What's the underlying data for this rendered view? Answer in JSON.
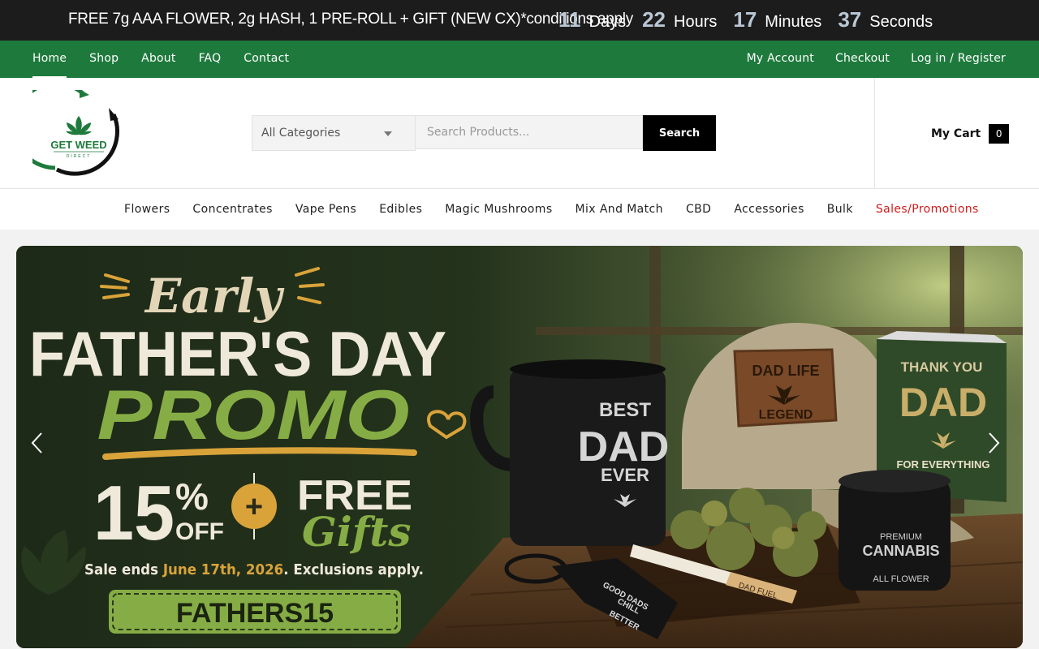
{
  "topbar": {
    "promo": "FREE 7g AAA FLOWER, 2g HASH, 1 PRE-ROLL + GIFT (NEW CX)*conditions apply",
    "countdown": {
      "days": "11",
      "days_label": "Days",
      "hours": "22",
      "hours_label": "Hours",
      "minutes": "17",
      "minutes_label": "Minutes",
      "seconds": "37",
      "seconds_label": "Seconds"
    }
  },
  "nav": {
    "left": [
      "Home",
      "Shop",
      "About",
      "FAQ",
      "Contact"
    ],
    "right": [
      "My Account",
      "Checkout",
      "Log in / Register"
    ],
    "active": "Home"
  },
  "header": {
    "logo_text": "GET WEED",
    "logo_subtext": "DIRECT",
    "search": {
      "category": "All Categories",
      "placeholder": "Search Products...",
      "button": "Search"
    },
    "cart": {
      "label": "My Cart",
      "count": "0"
    }
  },
  "categories": [
    "Flowers",
    "Concentrates",
    "Vape Pens",
    "Edibles",
    "Magic Mushrooms",
    "Mix And Match",
    "CBD",
    "Accessories",
    "Bulk",
    "Sales/Promotions"
  ],
  "banner": {
    "early": "Early",
    "headline": "FATHER'S DAY",
    "promo": "PROMO",
    "discount_number": "15",
    "discount_pct": "%",
    "discount_off": "OFF",
    "plus": "+",
    "free": "FREE",
    "gifts": "Gifts",
    "sale_prefix": "Sale ends ",
    "sale_date": "June 17th, 2026",
    "sale_suffix": ". Exclusions apply.",
    "code": "FATHERS15",
    "mug": [
      "BEST",
      "DAD",
      "EVER"
    ],
    "cap": [
      "DAD LIFE",
      "LEGEND"
    ],
    "card": [
      "THANK YOU",
      "DAD",
      "FOR EVERYTHING"
    ],
    "jar": [
      "PREMIUM",
      "CANNABIS",
      "ALL FLOWER"
    ],
    "opener": [
      "GOOD DADS",
      "CHILL",
      "BETTER"
    ],
    "joint": "DAD FUEL"
  },
  "colors": {
    "topbar_bg": "#1c1c1c",
    "nav_bg": "#1e7a3c",
    "accent_green": "#7aa83e",
    "sale_red": "#d11a1a",
    "gold": "#d9a33a"
  }
}
